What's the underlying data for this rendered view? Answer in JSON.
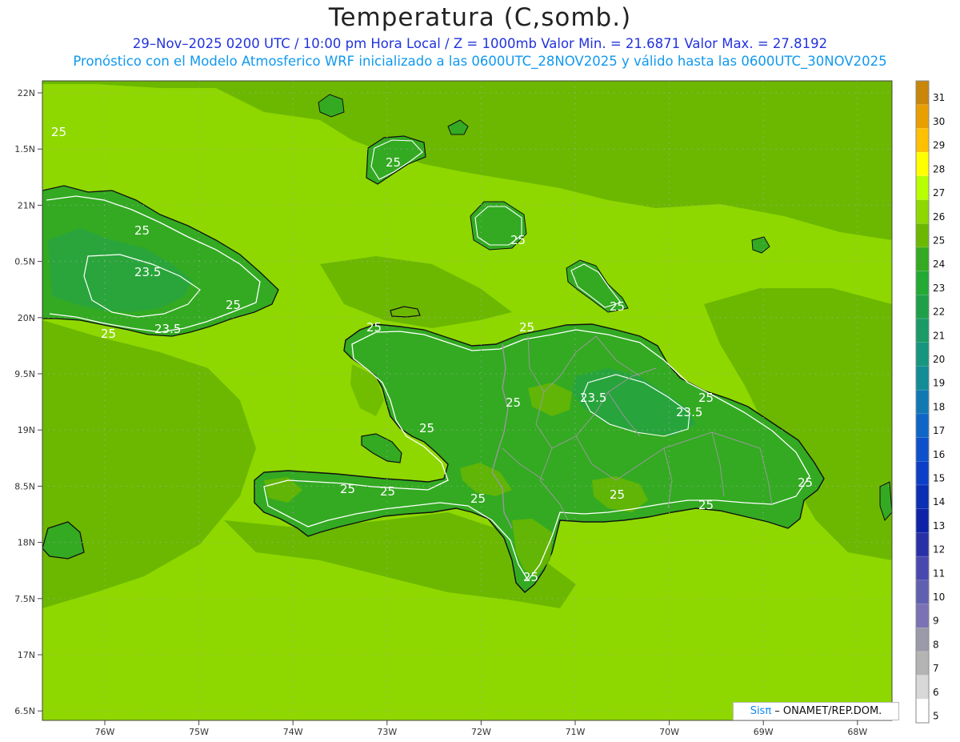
{
  "header": {
    "title": "Temperatura (C,somb.)",
    "line1": "29–Nov–2025 0200 UTC / 10:00 pm Hora Local / Z = 1000mb   Valor Min. = 21.6871   Valor Max. = 27.8192",
    "line2": "Pronóstico con el Modelo Atmosferico WRF inicializado a las 0600UTC_28NOV2025 y válido hasta las  0600UTC_30NOV2025"
  },
  "axes": {
    "lat_labels": [
      "22N",
      "1.5N",
      "21N",
      "0.5N",
      "20N",
      "9.5N",
      "19N",
      "8.5N",
      "18N",
      "7.5N",
      "17N",
      "6.5N"
    ],
    "lon_labels": [
      "76W",
      "75W",
      "74W",
      "73W",
      "72W",
      "71W",
      "70W",
      "69W",
      "68W"
    ]
  },
  "colorbar": {
    "labels": [
      "31",
      "30",
      "29",
      "28",
      "27",
      "26",
      "25",
      "24",
      "23",
      "22",
      "21",
      "20",
      "19",
      "18",
      "17",
      "16",
      "15",
      "14",
      "13",
      "12",
      "11",
      "10",
      "9",
      "8",
      "7",
      "6",
      "5"
    ],
    "colors": [
      "#c8860a",
      "#e8a000",
      "#ffc000",
      "#ffff00",
      "#b8ff00",
      "#8ed800",
      "#6cb800",
      "#33aa22",
      "#22aa33",
      "#1ea048",
      "#199a66",
      "#16967e",
      "#138c96",
      "#1178b4",
      "#0f66c6",
      "#0d50cc",
      "#0c3ec8",
      "#0a2eb4",
      "#0e22a8",
      "#2830a8",
      "#4848b0",
      "#6060b0",
      "#7a72b4",
      "#9a9aa8",
      "#b4b4b4",
      "#d8d8d8",
      "#ffffff"
    ]
  },
  "contour_labels": [
    {
      "text": "25"
    },
    {
      "text": "25"
    },
    {
      "text": "23.5"
    },
    {
      "text": "25"
    },
    {
      "text": "25"
    },
    {
      "text": "23.5"
    },
    {
      "text": "25"
    },
    {
      "text": "25"
    },
    {
      "text": "25"
    },
    {
      "text": "25"
    },
    {
      "text": "25"
    },
    {
      "text": "25"
    },
    {
      "text": "25"
    },
    {
      "text": "23.5"
    },
    {
      "text": "25"
    },
    {
      "text": "23.5"
    },
    {
      "text": "25"
    },
    {
      "text": "25"
    },
    {
      "text": "25"
    },
    {
      "text": "25"
    },
    {
      "text": "25"
    },
    {
      "text": "25"
    },
    {
      "text": "25"
    }
  ],
  "credit": {
    "sis": "Sisπ",
    "rest": " – ONAMET/REP.DOM."
  },
  "colors": {
    "sea_warm": "#8ed800",
    "mid": "#6cb800",
    "land_cool": "#33aa22",
    "coast": "#111111",
    "border": "#999999"
  }
}
